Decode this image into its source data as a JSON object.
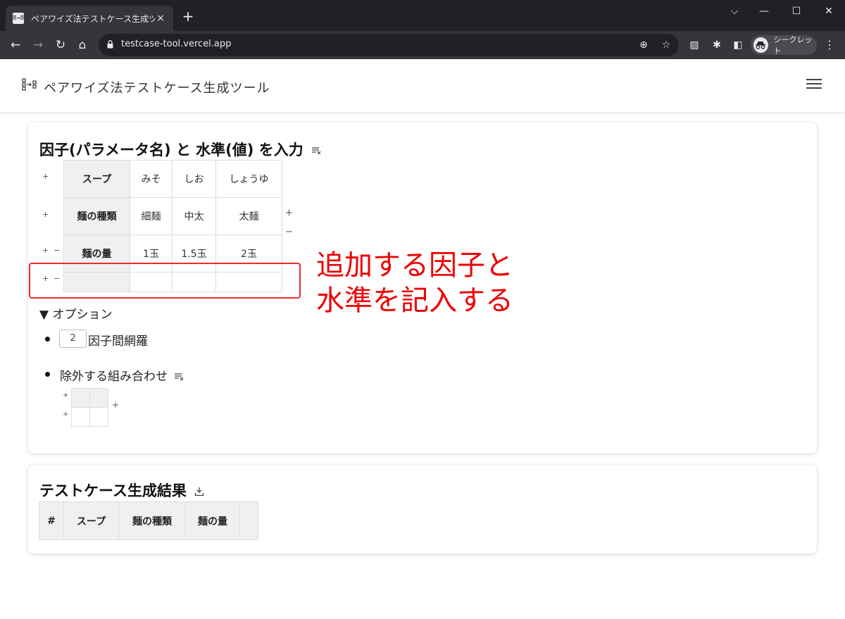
{
  "browser": {
    "tab_title": "ペアワイズ法テストケース生成ツール",
    "tab_close": "×",
    "new_tab": "+",
    "url": "testcase-tool.vercel.app",
    "profile_label": "シークレット",
    "icons": [
      "back-icon",
      "forward-icon",
      "reload-icon",
      "home-icon",
      "lock-icon",
      "zoom-icon",
      "bookmark-star-icon",
      "extension-icon",
      "puzzle-icon",
      "sidepanel-icon",
      "incognito-icon",
      "menu-icon"
    ]
  },
  "header": {
    "title": "ペアワイズ法テストケース生成ツール"
  },
  "input_section": {
    "title": "因子(パラメータ名) と 水準(値) を入力",
    "parameters": [
      {
        "name": "スープ",
        "values": [
          "みそ",
          "しお",
          "しょうゆ"
        ]
      },
      {
        "name": "麺の種類",
        "values": [
          "細麺",
          "中太",
          "太麺"
        ]
      },
      {
        "name": "麺の量",
        "values": [
          "1玉",
          "1.5玉",
          "2玉"
        ]
      },
      {
        "name": "",
        "values": [
          "",
          "",
          ""
        ]
      }
    ],
    "add_symbol": "+",
    "remove_symbol": "−",
    "annotation_line1": "追加する因子と",
    "annotation_line2": "水準を記入する",
    "annotation_color": "#ee0000"
  },
  "options": {
    "toggle_label": "▼ オプション",
    "strength_value": "2",
    "strength_label": "因子間網羅",
    "exclude_label": "除外する組み合わせ"
  },
  "result_section": {
    "title": "テストケース生成結果",
    "columns": [
      "#",
      "スープ",
      "麺の種類",
      "麺の量",
      ""
    ]
  }
}
